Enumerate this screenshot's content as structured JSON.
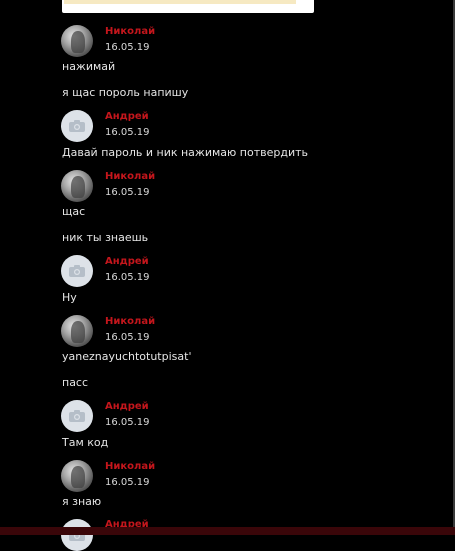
{
  "colors": {
    "background": "#000000",
    "author_name": "#c4161c",
    "text": "#e6e6e6"
  },
  "messages": [
    {
      "author": "Николай",
      "date": "16.05.19",
      "avatar": "photo-avatar",
      "lines": [
        "нажимай",
        "я щас пороль напишу"
      ]
    },
    {
      "author": "Андрей",
      "date": "16.05.19",
      "avatar": "camera-icon",
      "lines": [
        "Давай пароль и ник нажимаю потвердить"
      ]
    },
    {
      "author": "Николай",
      "date": "16.05.19",
      "avatar": "photo-avatar",
      "lines": [
        "щас",
        "ник ты знаешь"
      ]
    },
    {
      "author": "Андрей",
      "date": "16.05.19",
      "avatar": "camera-icon",
      "lines": [
        "Ну"
      ]
    },
    {
      "author": "Николай",
      "date": "16.05.19",
      "avatar": "photo-avatar",
      "lines": [
        "yaneznayuchtotutpisat'",
        "пасс"
      ]
    },
    {
      "author": "Андрей",
      "date": "16.05.19",
      "avatar": "camera-icon",
      "lines": [
        "Там код"
      ]
    },
    {
      "author": "Николай",
      "date": "16.05.19",
      "avatar": "photo-avatar",
      "lines": [
        "я знаю"
      ]
    },
    {
      "author": "Андрей",
      "date": "",
      "avatar": "camera-icon",
      "lines": []
    }
  ]
}
